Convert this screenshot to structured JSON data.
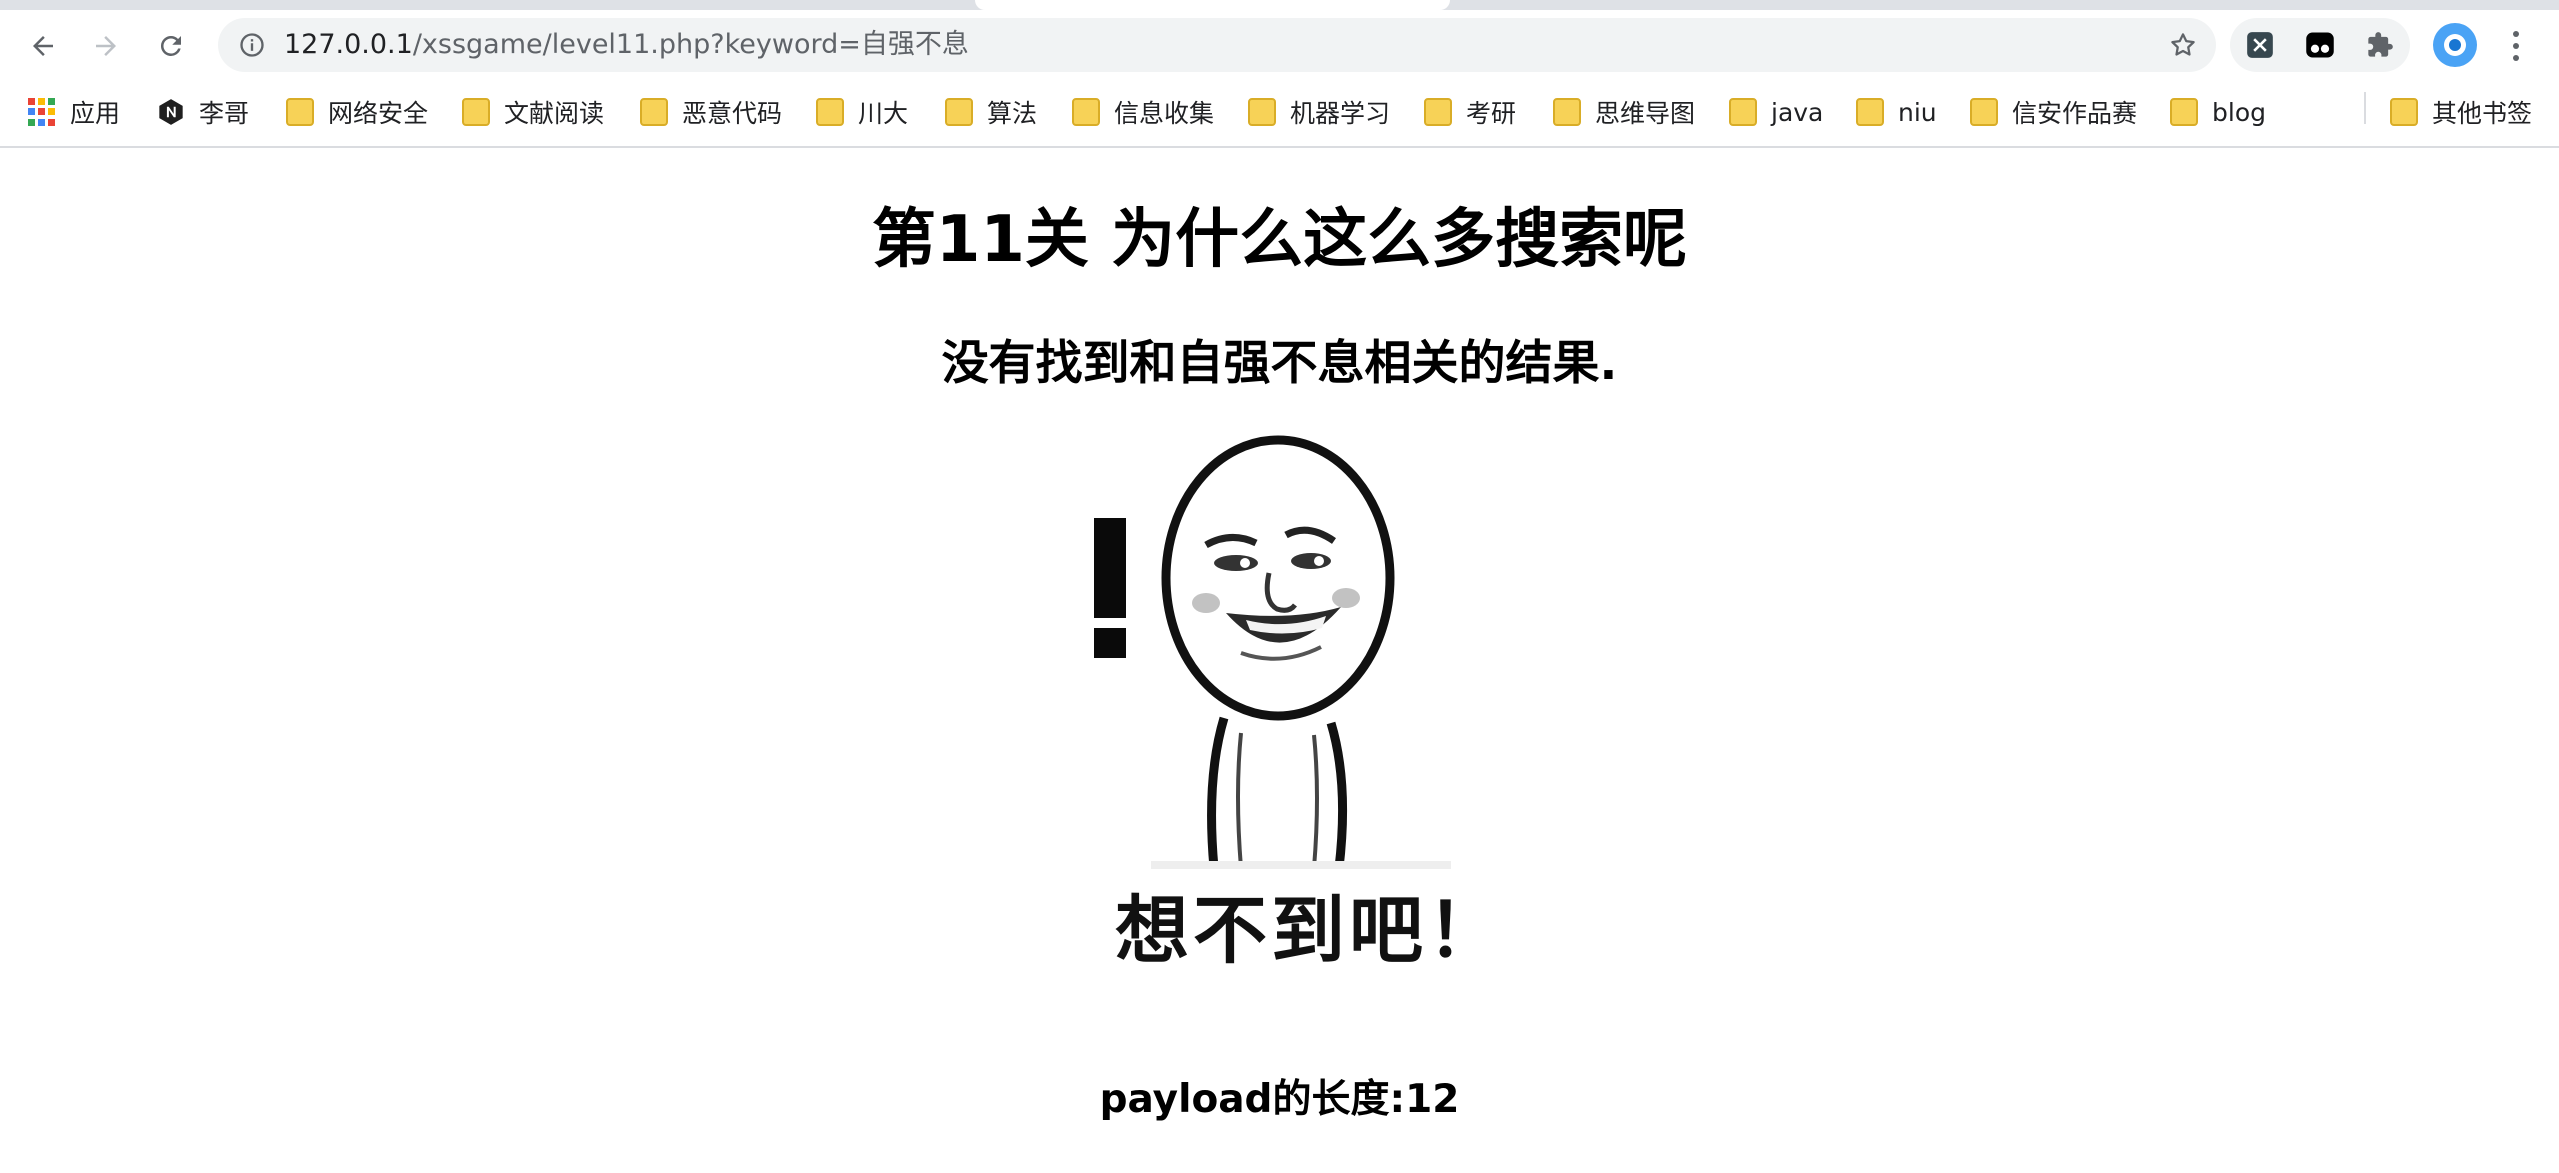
{
  "browser": {
    "url_host": "127.0.0.1",
    "url_path": "/xssgame/level11.php?keyword=自强不息",
    "bookmarks": [
      {
        "label": "应用",
        "icon": "apps-grid-icon"
      },
      {
        "label": "李哥",
        "icon": "n-logo-icon"
      },
      {
        "label": "网络安全",
        "icon": "folder-icon"
      },
      {
        "label": "文献阅读",
        "icon": "folder-icon"
      },
      {
        "label": "恶意代码",
        "icon": "folder-icon"
      },
      {
        "label": "川大",
        "icon": "folder-icon"
      },
      {
        "label": "算法",
        "icon": "folder-icon"
      },
      {
        "label": "信息收集",
        "icon": "folder-icon"
      },
      {
        "label": "机器学习",
        "icon": "folder-icon"
      },
      {
        "label": "考研",
        "icon": "folder-icon"
      },
      {
        "label": "思维导图",
        "icon": "folder-icon"
      },
      {
        "label": "java",
        "icon": "folder-icon"
      },
      {
        "label": "niu",
        "icon": "folder-icon"
      },
      {
        "label": "信安作品赛",
        "icon": "folder-icon"
      },
      {
        "label": "blog",
        "icon": "folder-icon"
      },
      {
        "label": "其他书签",
        "icon": "folder-icon"
      }
    ],
    "colors": {
      "folder": "#f7d257",
      "profile": "#4aa3f5"
    }
  },
  "page": {
    "title": "第11关 为什么这么多搜索呢",
    "result_text": "没有找到和自强不息相关的结果.",
    "meme_caption": "想不到吧！",
    "payload_length": "payload的长度:12"
  }
}
